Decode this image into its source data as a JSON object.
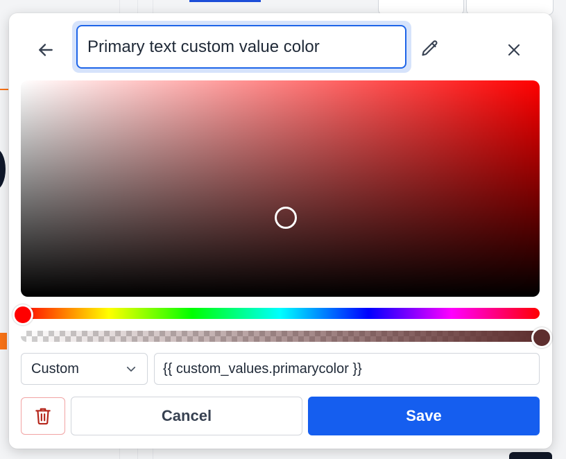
{
  "color_picker": {
    "title_value": "Primary text custom value color",
    "mode_label": "Custom",
    "custom_value": "{{ custom_values.primarycolor }}",
    "cancel_label": "Cancel",
    "save_label": "Save",
    "icons": {
      "back": "arrow-left-icon",
      "edit": "pencil-icon",
      "close": "close-icon",
      "dropdown": "chevron-down-icon",
      "delete": "trash-icon"
    },
    "selected_color": {
      "hue_degrees": 0,
      "saturation": 0.51,
      "value": 0.37,
      "alpha": 1.0,
      "swatch": "#5e2e2e"
    },
    "colors": {
      "primary": "#155eef",
      "focus_border": "#1d64e8",
      "danger": "#b42318"
    }
  }
}
